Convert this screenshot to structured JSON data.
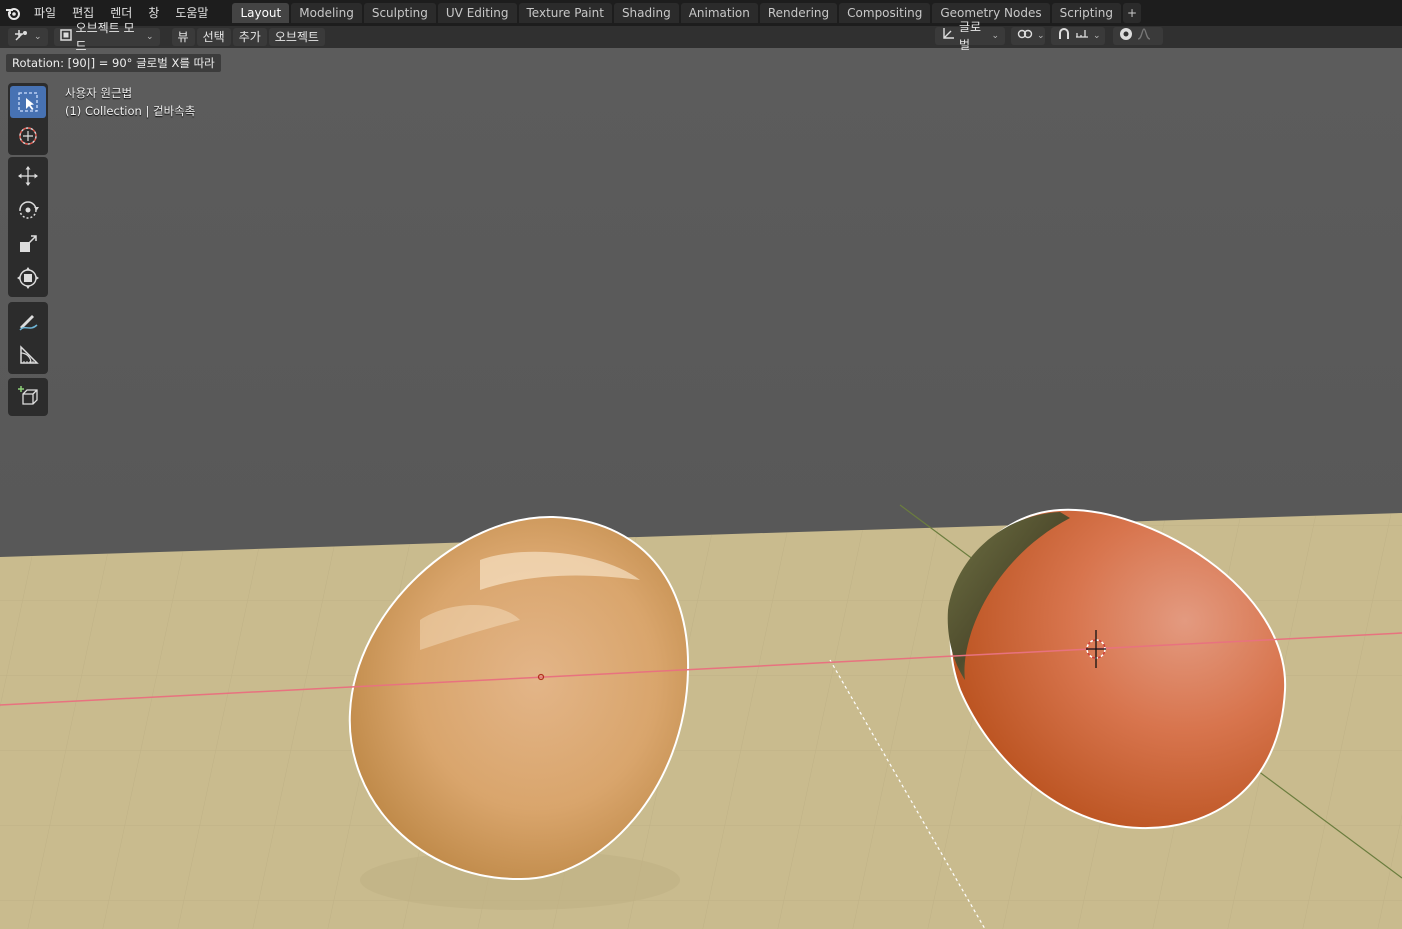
{
  "menu": {
    "items": [
      "파일",
      "편집",
      "렌더",
      "창",
      "도움말"
    ]
  },
  "workspaces": {
    "tabs": [
      "Layout",
      "Modeling",
      "Sculpting",
      "UV Editing",
      "Texture Paint",
      "Shading",
      "Animation",
      "Rendering",
      "Compositing",
      "Geometry Nodes",
      "Scripting"
    ],
    "active": "Layout",
    "add_label": "+"
  },
  "header": {
    "mode": "오브젝트 모드",
    "view": "뷰",
    "select": "선택",
    "add": "추가",
    "object": "오브젝트",
    "orientation": "글로벌"
  },
  "operator": {
    "info": "Rotation: [90|] = 90°  글로벌 X를 따라"
  },
  "viewport": {
    "view_name": "사용자 원근법",
    "collection": "(1) Collection | 겉바속촉"
  },
  "colors": {
    "accent": "#4772b3",
    "x_axis": "#e8727f",
    "y_axis": "#6b8b3a",
    "floor": "#c9bb8e",
    "sky": "#5a5a5a"
  },
  "tools": [
    "select-box-icon",
    "cursor-icon",
    "move-icon",
    "rotate-icon",
    "scale-icon",
    "transform-icon",
    "annotate-icon",
    "measure-icon",
    "add-cube-icon"
  ]
}
